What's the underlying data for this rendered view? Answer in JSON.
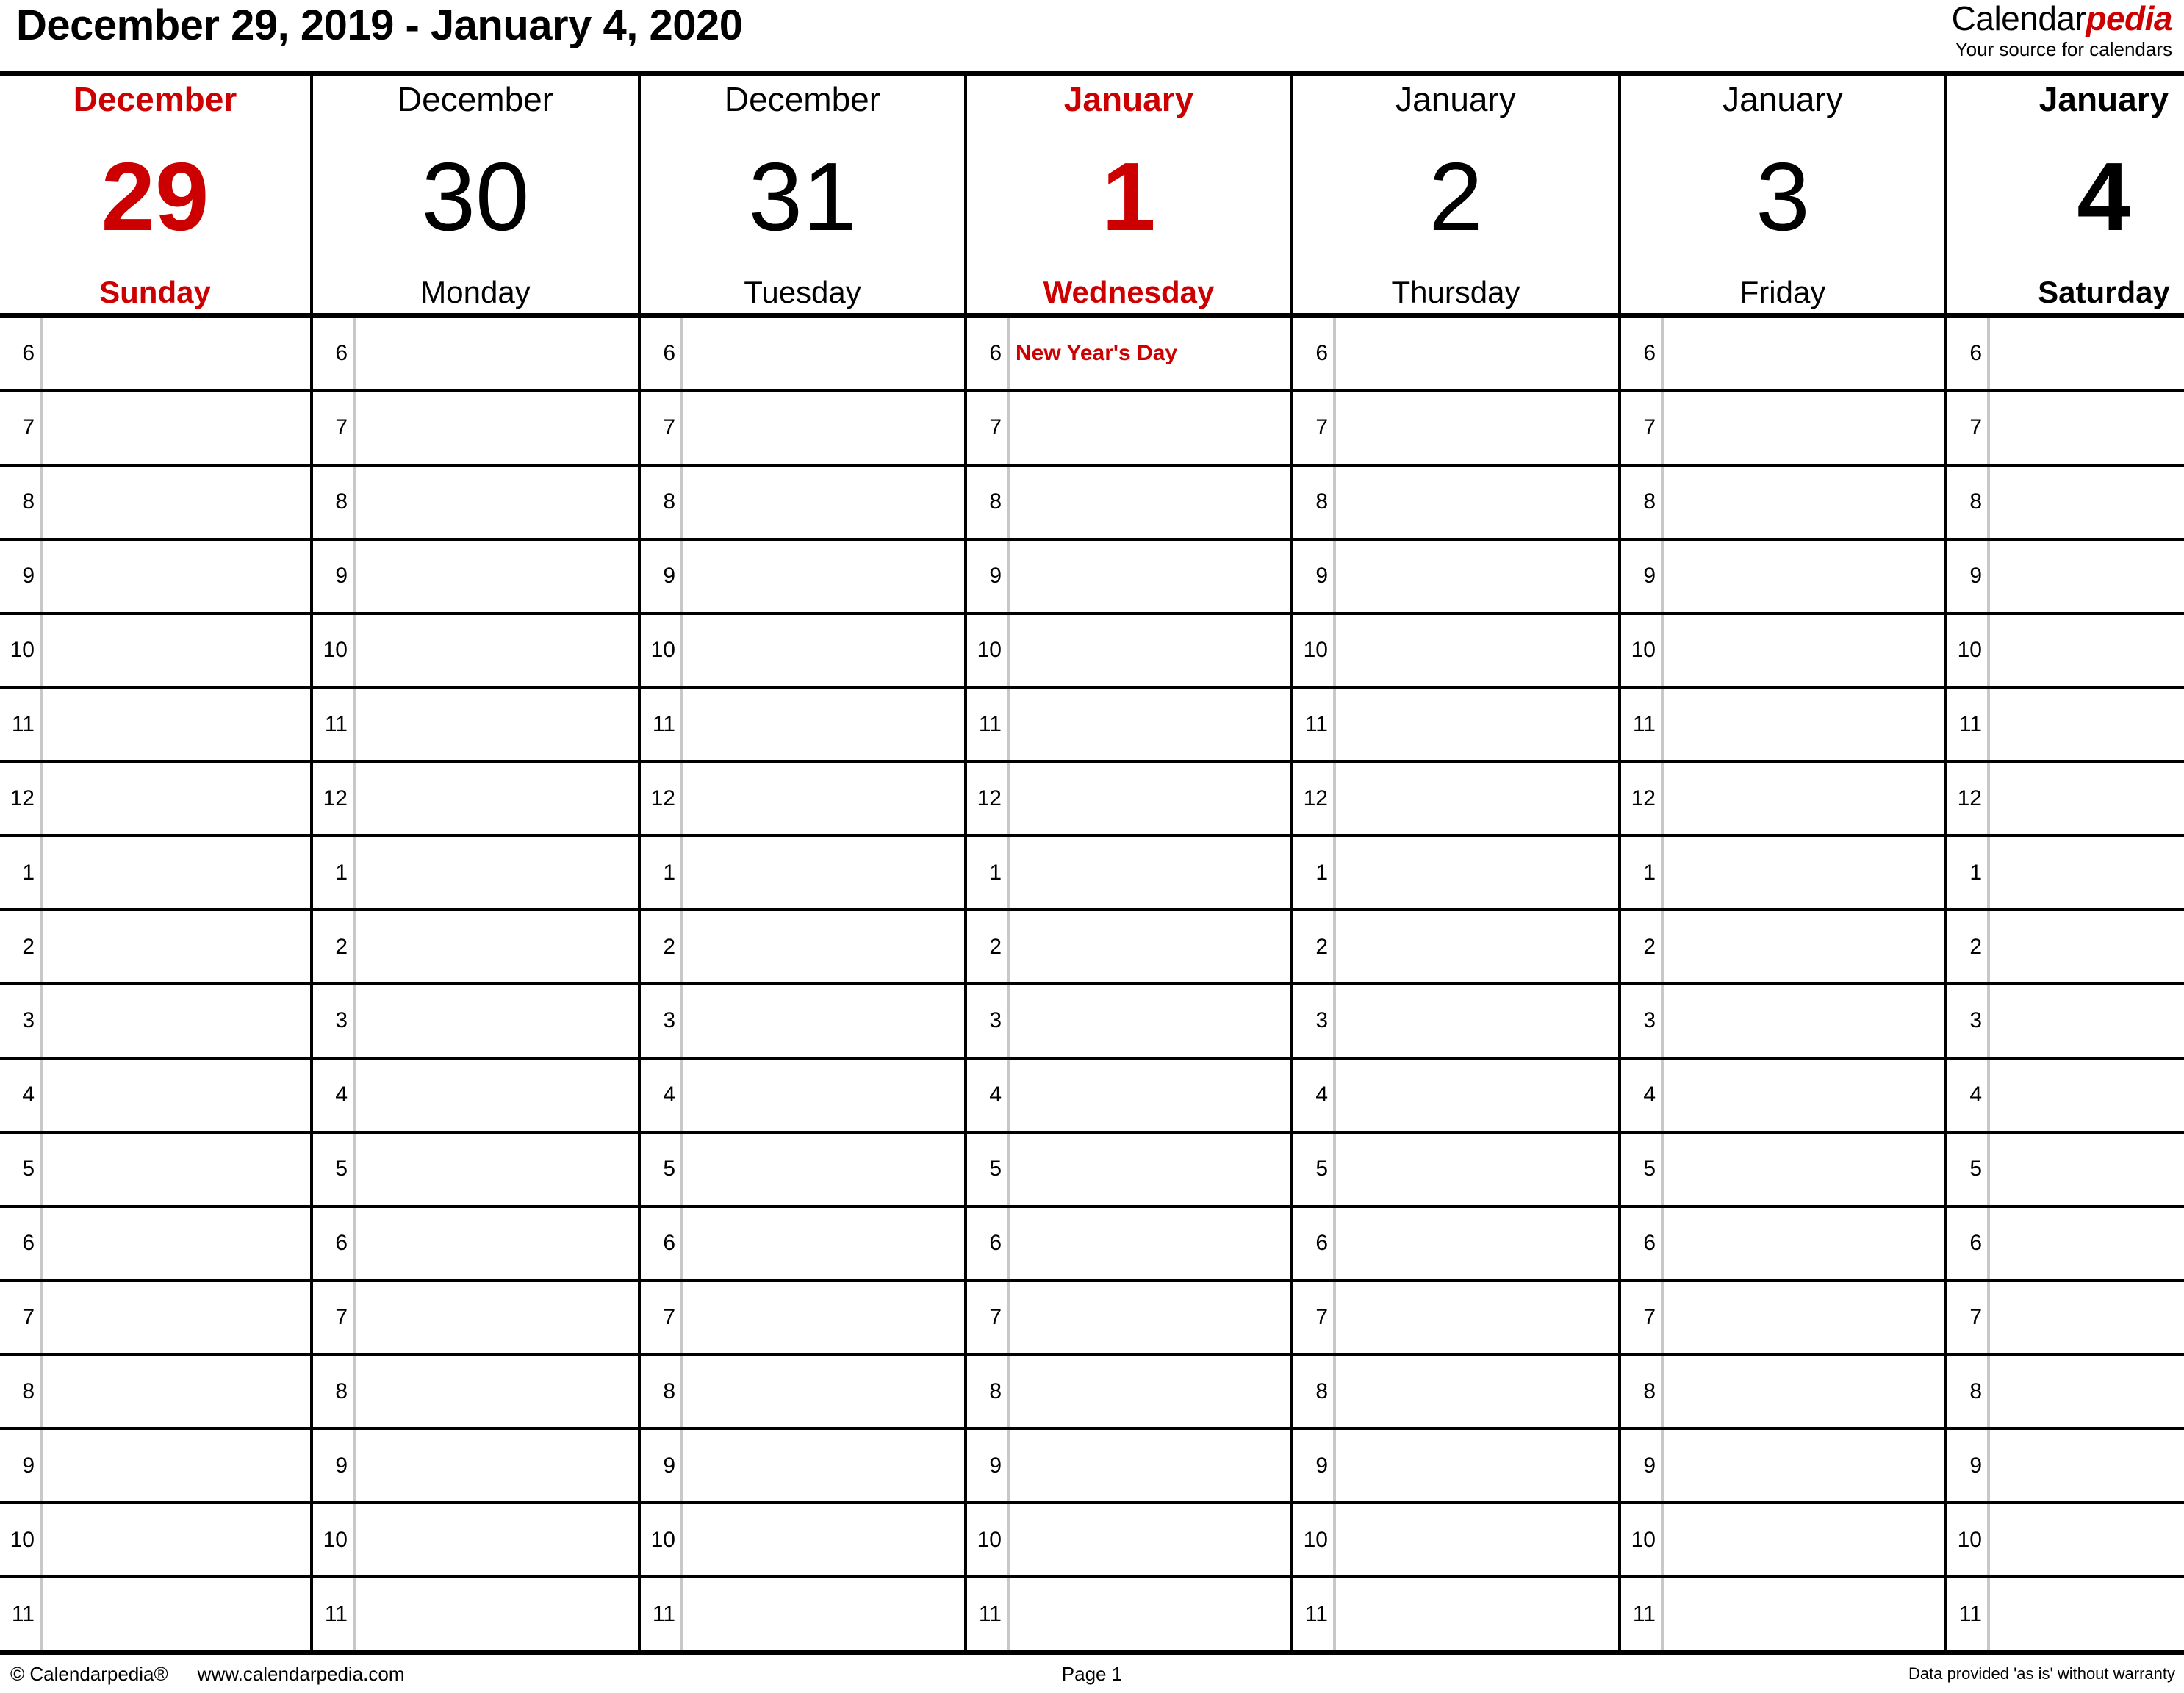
{
  "header": {
    "range_title": "December 29, 2019 - January 4, 2020",
    "brand_black": "Calendar",
    "brand_red": "pedia",
    "brand_tagline": "Your source for calendars"
  },
  "colors": {
    "accent_red": "#cc0000",
    "text_black": "#000000",
    "gutter_gray": "#c8c8c8",
    "background": "#ffffff"
  },
  "days": [
    {
      "month": "December",
      "number": "29",
      "weekday": "Sunday",
      "style": "holiday"
    },
    {
      "month": "December",
      "number": "30",
      "weekday": "Monday",
      "style": "normal"
    },
    {
      "month": "December",
      "number": "31",
      "weekday": "Tuesday",
      "style": "normal"
    },
    {
      "month": "January",
      "number": "1",
      "weekday": "Wednesday",
      "style": "holiday"
    },
    {
      "month": "January",
      "number": "2",
      "weekday": "Thursday",
      "style": "normal"
    },
    {
      "month": "January",
      "number": "3",
      "weekday": "Friday",
      "style": "normal"
    },
    {
      "month": "January",
      "number": "4",
      "weekday": "Saturday",
      "style": "weekend"
    }
  ],
  "hours": [
    "6",
    "7",
    "8",
    "9",
    "10",
    "11",
    "12",
    "1",
    "2",
    "3",
    "4",
    "5",
    "6",
    "7",
    "8",
    "9",
    "10",
    "11"
  ],
  "entries": [
    {
      "day_index": 3,
      "hour_index": 0,
      "text": "New Year's Day"
    }
  ],
  "footer": {
    "copyright": "© Calendarpedia®",
    "website": "www.calendarpedia.com",
    "page": "Page 1",
    "disclaimer": "Data provided 'as is' without warranty"
  }
}
